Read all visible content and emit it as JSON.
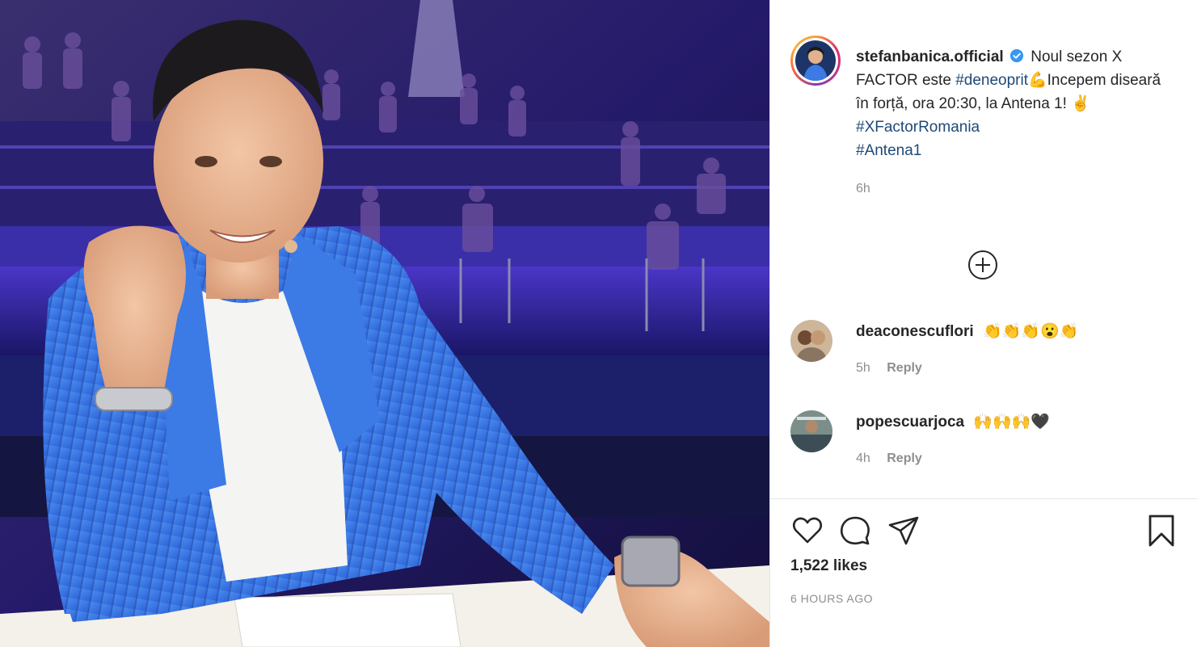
{
  "post": {
    "author": {
      "username": "stefanbanica.official",
      "verified": true
    },
    "caption": {
      "text_1": "Noul sezon X FACTOR este",
      "hashtag_1": "#deneoprit",
      "text_2": "💪Incepem diseară în forță, ora 20:30, la Antena 1! ✌️",
      "hashtag_2": "#XFactorRomania",
      "hashtag_3": "#Antena1",
      "time": "6h"
    },
    "comments": [
      {
        "username": "deaconescuflori",
        "text": "👏👏👏😮👏",
        "time": "5h",
        "reply_label": "Reply"
      },
      {
        "username": "popescuarjoca",
        "text": "🙌🙌🙌🖤",
        "time": "4h",
        "reply_label": "Reply"
      }
    ],
    "likes": "1,522 likes",
    "posted_ago": "6 HOURS AGO",
    "icons": {
      "like": "heart-icon",
      "comment": "comment-bubble-icon",
      "share": "paper-plane-icon",
      "save": "bookmark-icon",
      "add": "plus-circle-icon",
      "verified": "verified-badge-icon"
    },
    "colors": {
      "hashtag": "#1e4a78",
      "verified": "#3897f0",
      "muted": "#8e8e8e",
      "text": "#262626"
    }
  }
}
